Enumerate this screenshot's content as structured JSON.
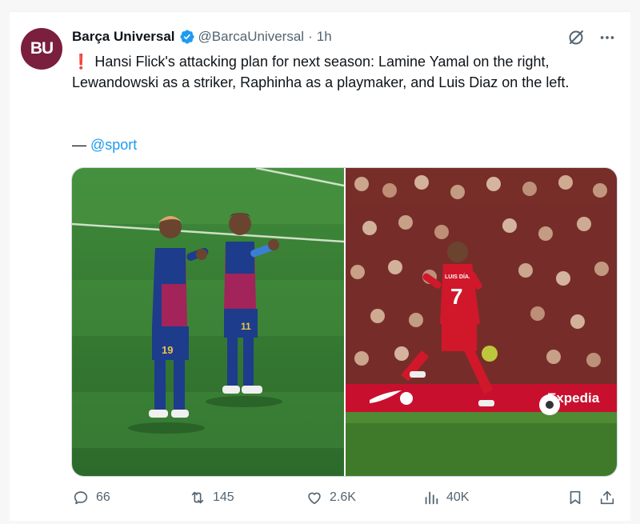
{
  "author": {
    "avatar_text": "BU",
    "name": "Barça Universal",
    "handle": "@BarcaUniversal",
    "separator": "·",
    "time": "1h",
    "avatar_color": "#7a1f3d",
    "verified_color": "#1d9bf0"
  },
  "tweet": {
    "alert_icon": "❗",
    "text": "Hansi Flick's attacking plan for next season: Lamine Yamal on the right, Lewandowski as a striker, Raphinha as a playmaker, and Luis Diaz on the left.",
    "source_prefix": "— ",
    "source_mention": "@sport"
  },
  "media": {
    "left_jersey_number": "19",
    "right_jersey_number": "7",
    "right_shirt_name": "LUIS DÍAZ",
    "ad_board_brand": "Expedia"
  },
  "actions": {
    "replies": "66",
    "reposts": "145",
    "likes": "2.6K",
    "views": "40K"
  },
  "icons": [
    "grok-icon",
    "more-icon",
    "verified-badge-icon",
    "reply-icon",
    "repost-icon",
    "like-icon",
    "views-icon",
    "bookmark-icon",
    "share-icon"
  ],
  "colors": {
    "accent": "#1d9bf0",
    "muted": "#536471",
    "alert": "#e0245e"
  }
}
